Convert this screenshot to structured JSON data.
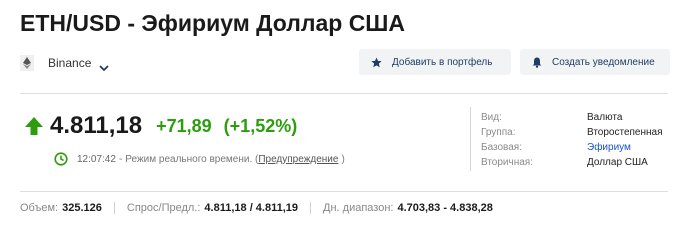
{
  "header": {
    "title": "ETH/USD - Эфириум Доллар США",
    "exchange": "Binance",
    "add_to_portfolio": "Добавить в портфель",
    "create_alert": "Создать уведомление"
  },
  "quote": {
    "price": "4.811,18",
    "change": "+71,89",
    "change_pct": "(+1,52%)",
    "time": "12:07:42",
    "realtime_text": "Режим реального времени. (",
    "warning": "Предупреждение",
    "close_paren": ")"
  },
  "info": {
    "type_label": "Вид:",
    "type_value": "Валюта",
    "group_label": "Группа:",
    "group_value": "Второстепенная",
    "base_label": "Базовая:",
    "base_value": "Эфириум",
    "secondary_label": "Вторичная:",
    "secondary_value": "Доллар США"
  },
  "stats": {
    "volume_label": "Объем:",
    "volume_value": "325.126",
    "bidask_label": "Спрос/Предл.:",
    "bidask_value": "4.811,18 / 4.811,19",
    "range_label": "Дн. диапазон:",
    "range_value": "4.703,83 - 4.838,28"
  },
  "colors": {
    "up_green": "#2d9d0f",
    "link_blue": "#1a56c2",
    "button_text": "#1f3d66",
    "button_bg": "#f2f3f5"
  },
  "icons": [
    "ethereum-icon",
    "chevron-down-icon",
    "star-icon",
    "bell-icon",
    "arrow-up-icon",
    "clock-icon"
  ]
}
